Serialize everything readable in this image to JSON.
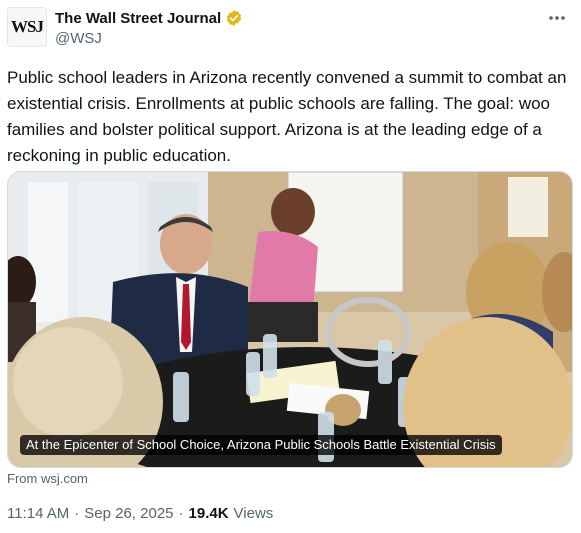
{
  "author": {
    "avatar_text": "WSJ",
    "display_name": "The Wall Street Journal",
    "handle": "@WSJ",
    "verified_color": "#e2b719"
  },
  "more_icon": "more-horizontal-icon",
  "tweet": {
    "text": "Public school leaders in Arizona recently convened a summit to combat an existential crisis. Enrollments at public schools are falling. The goal: woo families and bolster political support. Arizona is at the leading edge of a reckoning in public education."
  },
  "card": {
    "caption": "At the Epicenter of School Choice, Arizona Public Schools Battle Existential Crisis",
    "source": "From wsj.com"
  },
  "meta": {
    "time": "11:14 AM",
    "separator1": "·",
    "date": "Sep 26, 2025",
    "separator2": "·",
    "views_count": "19.4K",
    "views_label": "Views"
  }
}
